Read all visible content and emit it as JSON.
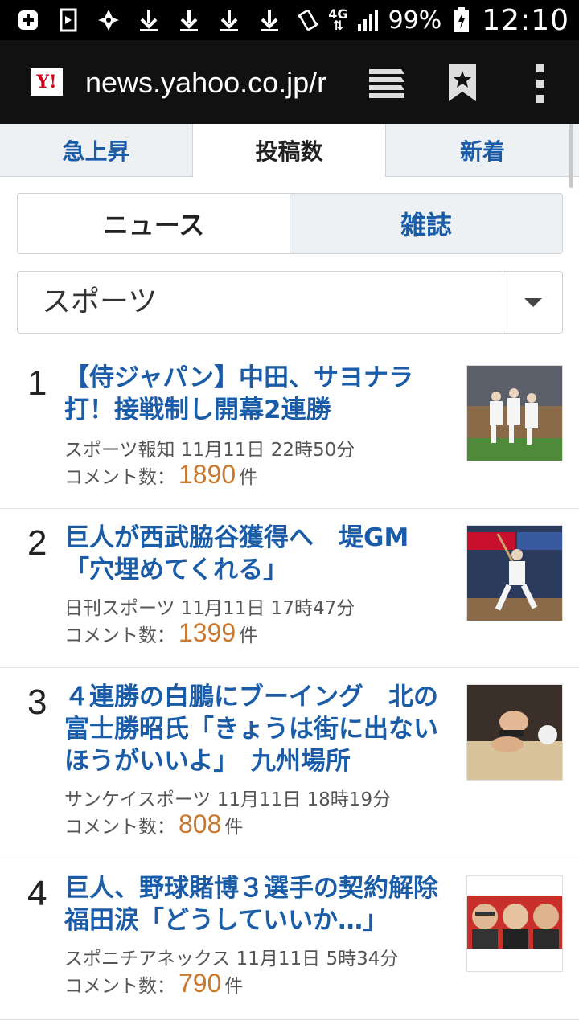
{
  "status_bar": {
    "battery": "99%",
    "network": "4G",
    "time": "12:10"
  },
  "browser": {
    "logo": "Y!",
    "url": "news.yahoo.co.jp/r"
  },
  "tabs": [
    "急上昇",
    "投稿数",
    "新着"
  ],
  "segment": [
    "ニュース",
    "雑誌"
  ],
  "category": "スポーツ",
  "comment_label": "コメント数：",
  "comment_unit": "件",
  "articles": [
    {
      "rank": "1",
      "title": "【侍ジャパン】中田、サヨナラ打！接戦制し開幕2連勝",
      "source": "スポーツ報知 11月11日 22時50分",
      "comments": "1890"
    },
    {
      "rank": "2",
      "title": "巨人が西武脇谷獲得へ　堤GM「穴埋めてくれる」",
      "source": "日刊スポーツ 11月11日 17時47分",
      "comments": "1399"
    },
    {
      "rank": "3",
      "title": "４連勝の白鵬にブーイング　北の富士勝昭氏「きょうは街に出ないほうがいいよ」　九州場所",
      "source": "サンケイスポーツ 11月11日 18時19分",
      "comments": "808"
    },
    {
      "rank": "4",
      "title": "巨人、野球賭博３選手の契約解除　福田涙「どうしていいか…」",
      "source": "スポニチアネックス 11月11日 5時34分",
      "comments": "790"
    }
  ],
  "colors": {
    "link": "#1a5ca8",
    "count": "#c9782d",
    "tab_inactive_bg": "#eef1f4"
  }
}
